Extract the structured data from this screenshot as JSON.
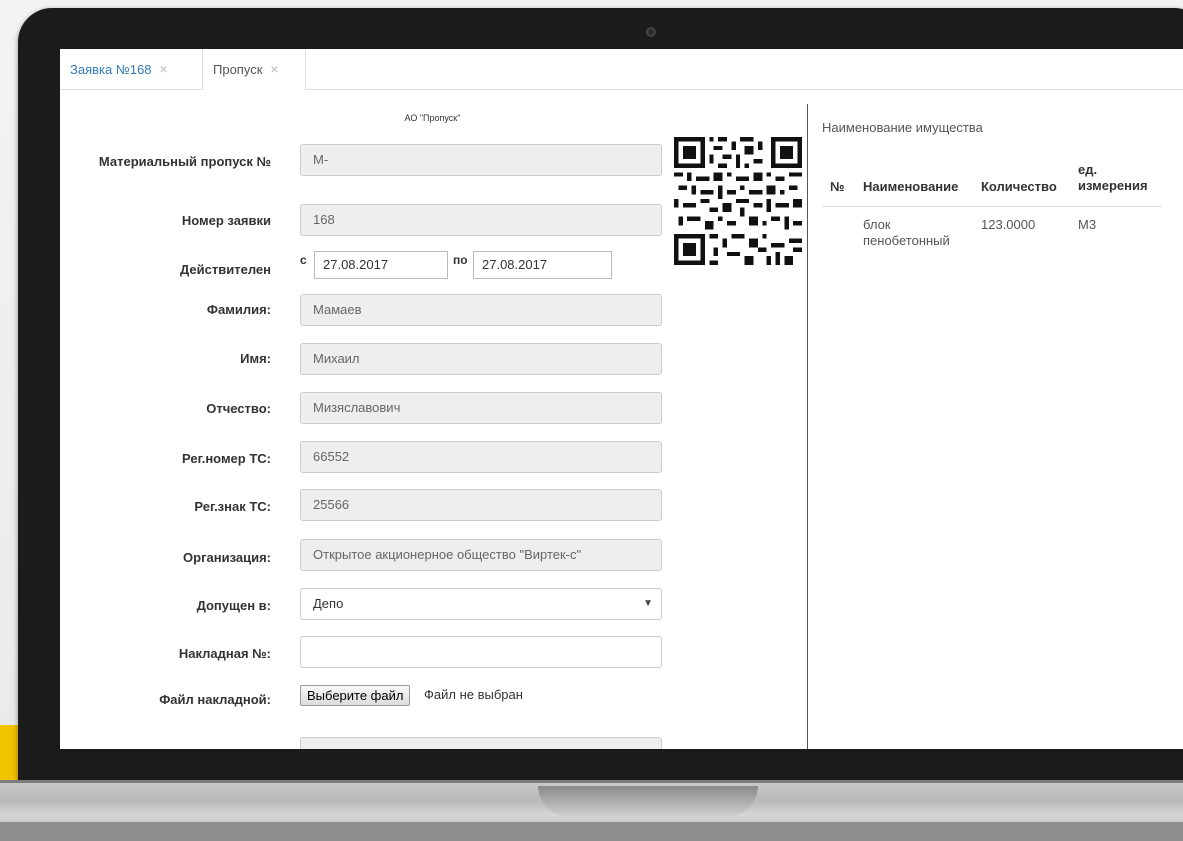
{
  "tabs": [
    {
      "label": "Заявка №168",
      "close": "×"
    },
    {
      "label": "Пропуск",
      "close": "×"
    }
  ],
  "form": {
    "org_header": "АО \"Пропуск\"",
    "pass_number_label": "Материальный пропуск №",
    "pass_number_value": "М-",
    "request_number_label": "Номер заявки",
    "request_number_value": "168",
    "valid_label": "Действителен",
    "valid_from_prefix": "с",
    "valid_from": "27.08.2017",
    "valid_to_prefix": "по",
    "valid_to": "27.08.2017",
    "surname_label": "Фамилия:",
    "surname_value": "Мамаев",
    "name_label": "Имя:",
    "name_value": "Михаил",
    "patronymic_label": "Отчество:",
    "patronymic_value": "Мизяславович",
    "vehicle_reg_label": "Рег.номер ТС:",
    "vehicle_reg_value": "66552",
    "vehicle_plate_label": "Рег.знак ТС:",
    "vehicle_plate_value": "25566",
    "organization_label": "Организация:",
    "organization_value": "Открытое акционерное общество \"Виртек-с\"",
    "admitted_label": "Допущен в:",
    "admitted_value": "Депо",
    "invoice_label": "Накладная №:",
    "invoice_value": "",
    "invoice_file_label": "Файл накладной:",
    "file_button": "Выберите файл",
    "file_status": "Файл не выбран"
  },
  "property": {
    "title": "Наименование имущества",
    "columns": [
      "№",
      "Наименование",
      "Количество",
      "ед. измерения"
    ],
    "rows": [
      {
        "num": "",
        "name": "блок пенобетонный",
        "qty": "123.0000",
        "unit": "М3"
      }
    ]
  },
  "icons": {
    "qr": "qr-code-icon",
    "dropdown": "chevron-down-icon",
    "close": "close-icon"
  },
  "colors": {
    "link": "#337ab7",
    "accent": "#f2c300",
    "field_readonly": "#eeeeee"
  }
}
